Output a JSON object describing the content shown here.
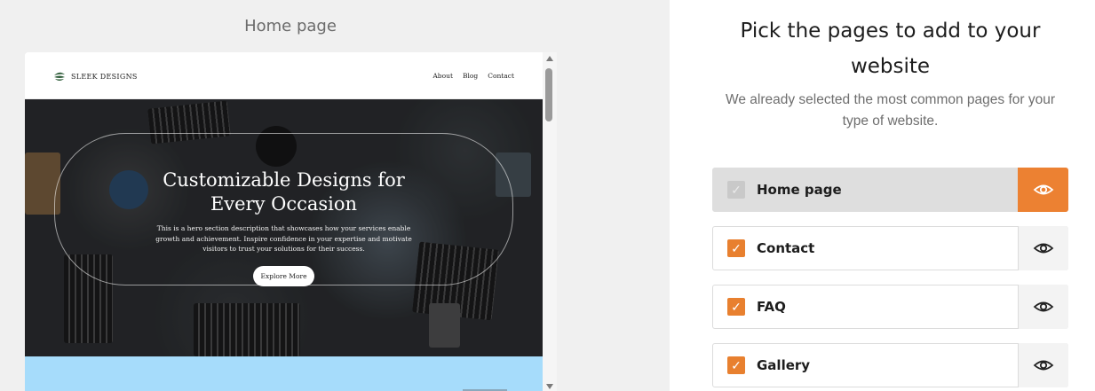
{
  "preview": {
    "title": "Home page",
    "site": {
      "brand": "SLEEK DESIGNS",
      "nav": [
        "About",
        "Blog",
        "Contact"
      ],
      "hero_title_line1": "Customizable Designs for",
      "hero_title_line2": "Every Occasion",
      "hero_desc": "This is a hero section description that showcases how your services enable growth and achievement. Inspire confidence in your expertise and motivate visitors to trust your solutions for their success.",
      "hero_button": "Explore More"
    }
  },
  "picker": {
    "title_line1": "Pick the pages to add to your",
    "title_line2": "website",
    "subtitle_line1": "We already selected the most common pages for your",
    "subtitle_line2": "type of website.",
    "pages": [
      {
        "label": "Home page",
        "checked": true,
        "disabled": true,
        "previewing": true
      },
      {
        "label": "Contact",
        "checked": true,
        "disabled": false,
        "previewing": false
      },
      {
        "label": "FAQ",
        "checked": true,
        "disabled": false,
        "previewing": false
      },
      {
        "label": "Gallery",
        "checked": true,
        "disabled": false,
        "previewing": false
      }
    ]
  },
  "colors": {
    "accent": "#ec8132",
    "next_section_bg": "#a6dcfb"
  },
  "icons": {
    "checkbox": "checkmark-icon",
    "preview": "eye-icon",
    "logo": "leaf-logo-icon"
  }
}
